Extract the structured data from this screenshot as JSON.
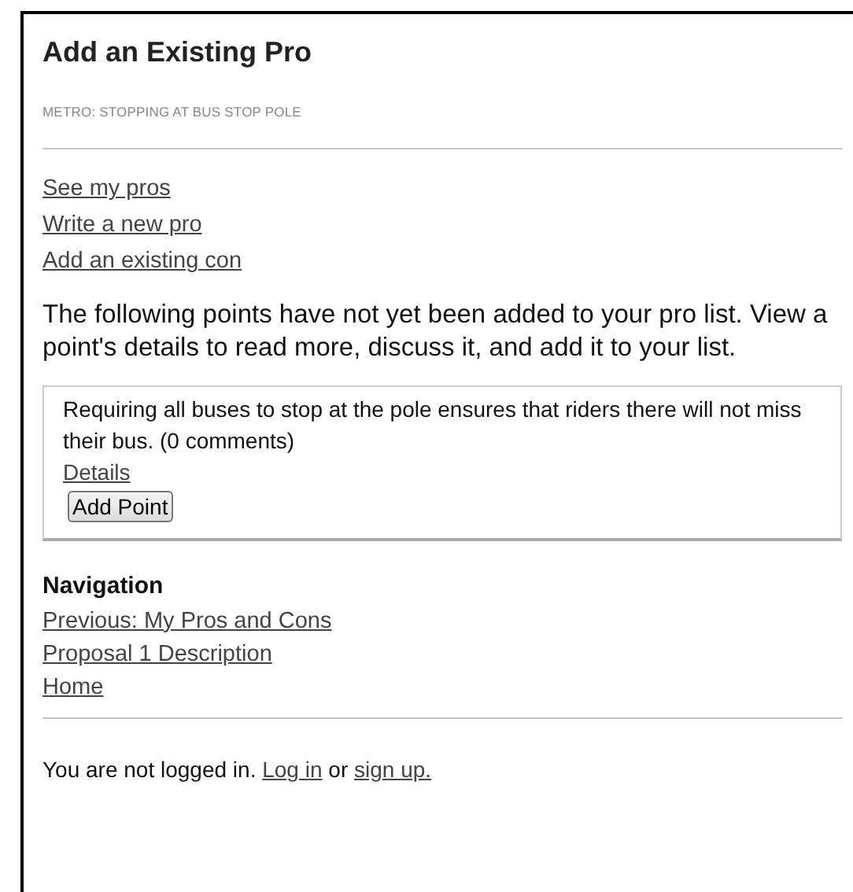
{
  "title": "Add an Existing Pro",
  "subtitle": "METRO: STOPPING AT BUS STOP POLE",
  "links": [
    "See my pros",
    "Write a new pro",
    "Add an existing con"
  ],
  "intro": "The following points have not yet been added to your pro list. View a point's details to read more, discuss it, and add it to your list.",
  "points": [
    {
      "text": "Requiring all buses to stop at the pole ensures that riders there will not miss their bus. (0 comments)",
      "details": "Details",
      "button": "Add Point"
    }
  ],
  "navigation": {
    "heading": "Navigation",
    "links": [
      "Previous: My Pros and Cons",
      "Proposal 1 Description",
      "Home"
    ]
  },
  "footer": {
    "text": "You are not logged in.",
    "login": "Log in",
    "or": "or",
    "signup": "sign up."
  }
}
